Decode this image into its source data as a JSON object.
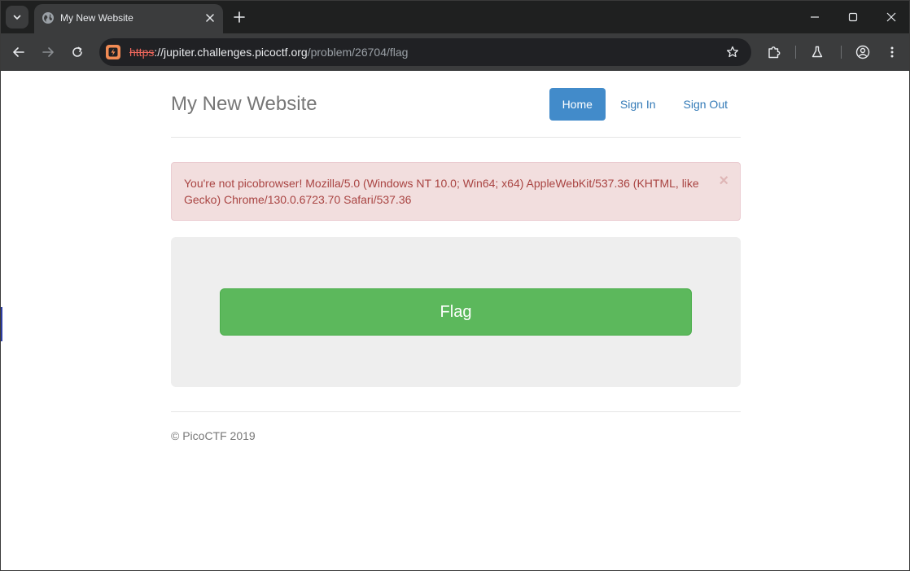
{
  "browser": {
    "tab": {
      "title": "My New Website"
    },
    "address": {
      "scheme": "https",
      "host": "://jupiter.challenges.picoctf.org",
      "path": "/problem/26704/flag"
    }
  },
  "site": {
    "brand": "My New Website",
    "nav": [
      {
        "label": "Home",
        "active": true
      },
      {
        "label": "Sign In",
        "active": false
      },
      {
        "label": "Sign Out",
        "active": false
      }
    ],
    "alert": {
      "message": "You're not picobrowser! Mozilla/5.0 (Windows NT 10.0; Win64; x64) AppleWebKit/537.36 (KHTML, like Gecko) Chrome/130.0.6723.70 Safari/537.36",
      "close_glyph": "×"
    },
    "flag_button": "Flag",
    "footer": "© PicoCTF 2019"
  },
  "colors": {
    "nav_active": "#428bca",
    "link": "#337ab7",
    "alert_bg": "#f2dede",
    "alert_text": "#a94442",
    "flag_button": "#5cb85c"
  }
}
